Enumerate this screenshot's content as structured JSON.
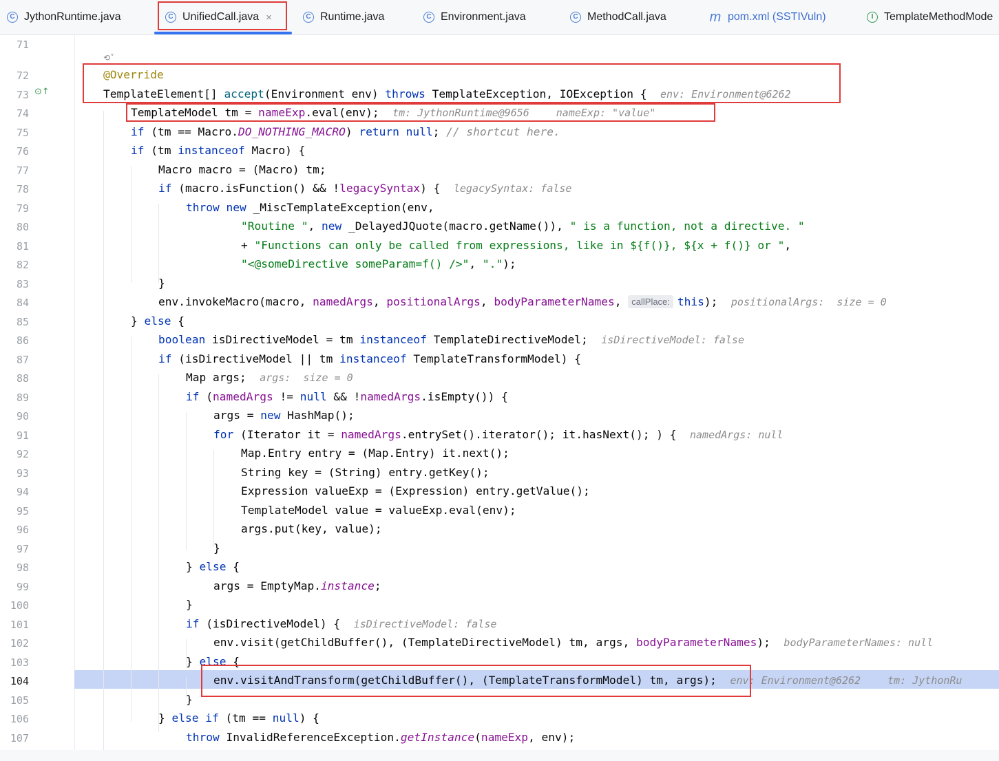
{
  "tabs": [
    {
      "label": "JythonRuntime.java",
      "icon": "class-icon"
    },
    {
      "label": "UnifiedCall.java",
      "icon": "class-icon",
      "active": true
    },
    {
      "label": "Runtime.java",
      "icon": "class-icon"
    },
    {
      "label": "Environment.java",
      "icon": "class-icon"
    },
    {
      "label": "MethodCall.java",
      "icon": "class-icon"
    },
    {
      "label": "pom.xml (SSTIVuln)",
      "icon": "maven-icon"
    },
    {
      "label": "TemplateMethodMode",
      "icon": "interface-icon"
    }
  ],
  "tab_close_glyph": "×",
  "line_numbers": [
    "71",
    "72",
    "73",
    "74",
    "75",
    "76",
    "77",
    "78",
    "79",
    "80",
    "81",
    "82",
    "83",
    "84",
    "85",
    "86",
    "87",
    "88",
    "89",
    "90",
    "91",
    "92",
    "93",
    "94",
    "95",
    "96",
    "97",
    "98",
    "99",
    "100",
    "101",
    "102",
    "103",
    "104",
    "105",
    "106",
    "107"
  ],
  "current_line": "104",
  "code": {
    "l72_annotation": "@Override",
    "l73_a": "TemplateElement[] ",
    "l73_b": "accept",
    "l73_c": "(Environment env) ",
    "l73_d": "throws",
    "l73_e": " TemplateException, IOException {",
    "l73_hint": "env: Environment@6262",
    "l74_a": "TemplateModel tm = ",
    "l74_b": "nameExp",
    "l74_c": ".eval(env);",
    "l74_hint1": "tm: JythonRuntime@9656",
    "l74_hint2": "nameExp: \"value\"",
    "l75_a": "if",
    "l75_b": " (tm == Macro.",
    "l75_c": "DO_NOTHING_MACRO",
    "l75_d": ") ",
    "l75_e": "return null",
    "l75_f": "; ",
    "l75_g": "// shortcut here.",
    "l76_a": "if",
    "l76_b": " (tm ",
    "l76_c": "instanceof",
    "l76_d": " Macro) {",
    "l77": "Macro macro = (Macro) tm;",
    "l78_a": "if",
    "l78_b": " (macro.isFunction() && !",
    "l78_c": "legacySyntax",
    "l78_d": ") {",
    "l78_hint": "legacySyntax: false",
    "l79_a": "throw new",
    "l79_b": " _MiscTemplateException(env,",
    "l80_a": "\"Routine \"",
    "l80_b": ", ",
    "l80_c": "new",
    "l80_d": " _DelayedJQuote(macro.getName()), ",
    "l80_e": "\" is a function, not a directive. \"",
    "l81_a": "+ ",
    "l81_b": "\"Functions can only be called from expressions, like in ${f()}, ${x + f()} or \"",
    "l81_c": ",",
    "l82_a": "\"<@someDirective someParam=f() />\"",
    "l82_b": ", ",
    "l82_c": "\".\"",
    "l82_d": ");",
    "l83": "}",
    "l84_a": "env.invokeMacro(macro, ",
    "l84_b": "namedArgs",
    "l84_c": ", ",
    "l84_d": "positionalArgs",
    "l84_e": ", ",
    "l84_f": "bodyParameterNames",
    "l84_g": ", ",
    "l84_param": "callPlace:",
    "l84_h": "this",
    "l84_i": ");",
    "l84_hint": "positionalArgs:  size = 0",
    "l85_a": "} ",
    "l85_b": "else",
    "l85_c": " {",
    "l86_a": "boolean",
    "l86_b": " isDirectiveModel = tm ",
    "l86_c": "instanceof",
    "l86_d": " TemplateDirectiveModel;",
    "l86_hint": "isDirectiveModel: false",
    "l87_a": "if",
    "l87_b": " (isDirectiveModel || tm ",
    "l87_c": "instanceof",
    "l87_d": " TemplateTransformModel) {",
    "l88": "Map args;",
    "l88_hint": "args:  size = 0",
    "l89_a": "if",
    "l89_b": " (",
    "l89_c": "namedArgs",
    "l89_d": " != ",
    "l89_e": "null",
    "l89_f": " && !",
    "l89_g": "namedArgs",
    "l89_h": ".isEmpty()) {",
    "l90_a": "args = ",
    "l90_b": "new",
    "l90_c": " HashMap();",
    "l91_a": "for",
    "l91_b": " (Iterator it = ",
    "l91_c": "namedArgs",
    "l91_d": ".entrySet().iterator(); it.hasNext(); ) {",
    "l91_hint": "namedArgs: null",
    "l92": "Map.Entry entry = (Map.Entry) it.next();",
    "l93": "String key = (String) entry.getKey();",
    "l94": "Expression valueExp = (Expression) entry.getValue();",
    "l95": "TemplateModel value = valueExp.eval(env);",
    "l96": "args.put(key, value);",
    "l97": "}",
    "l98_a": "} ",
    "l98_b": "else",
    "l98_c": " {",
    "l99_a": "args = EmptyMap.",
    "l99_b": "instance",
    "l99_c": ";",
    "l100": "}",
    "l101_a": "if",
    "l101_b": " (isDirectiveModel) {",
    "l101_hint": "isDirectiveModel: false",
    "l102_a": "env.visit(getChildBuffer(), (TemplateDirectiveModel) tm, args, ",
    "l102_b": "bodyParameterNames",
    "l102_c": ");",
    "l102_hint": "bodyParameterNames: null",
    "l103_a": "} ",
    "l103_b": "else",
    "l103_c": " {",
    "l104": "env.visitAndTransform(getChildBuffer(), (TemplateTransformModel) tm, args);",
    "l104_hint1": "env: Environment@6262",
    "l104_hint2": "tm: JythonRu",
    "l105": "}",
    "l106_a": "} ",
    "l106_b": "else if",
    "l106_c": " (tm == ",
    "l106_d": "null",
    "l106_e": ") {",
    "l107_a": "throw",
    "l107_b": " InvalidReferenceException.",
    "l107_c": "getInstance",
    "l107_d": "(",
    "l107_e": "nameExp",
    "l107_f": ", env);"
  },
  "colors": {
    "keyword": "#0033b3",
    "string": "#067d17",
    "field": "#871094",
    "annotation": "#9e880d",
    "comment": "#8c8c8c",
    "current_line_bg": "#c6d5f5",
    "highlight_box": "#e03a3a"
  }
}
